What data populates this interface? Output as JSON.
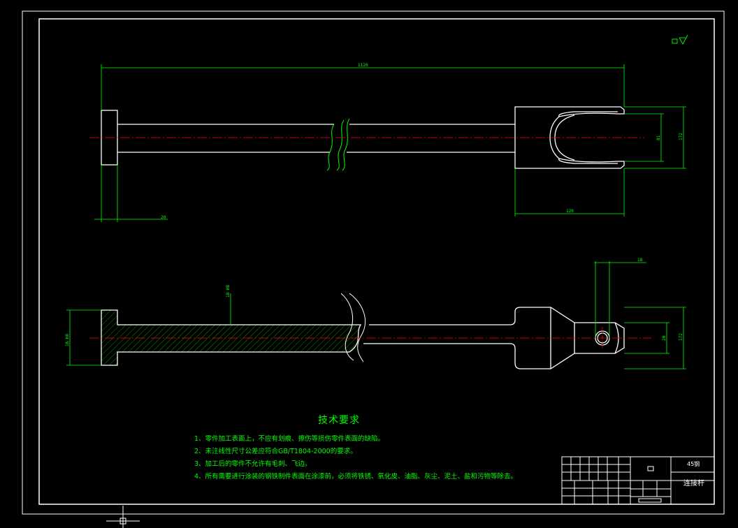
{
  "drawing": {
    "dimensions": {
      "overall_length": "1120",
      "head_thickness": "20",
      "fork_length": "120",
      "fork_opening": "81",
      "fork_height": "172",
      "bottom_slot": "20",
      "pin_hole": "18",
      "bottom_fork_height": "172",
      "shaft_dia": "18 H8",
      "head_dia": "16 H8"
    },
    "symbol_label": "▭∀"
  },
  "technical_requirements": {
    "title": "技术要求",
    "items": [
      "1、零件加工表面上，不应有划痕、擦伤等损伤零件表面的缺陷。",
      "2、未注线性尺寸公差应符合GB/T1804-2000的要求。",
      "3、加工后的零件不允许有毛刺、飞边。",
      "4、所有需要进行涂装的钢铁制件表面在涂漆前，必须将铁锈、氧化皮、油脂、灰尘、泥土、盐和污物等除去。"
    ]
  },
  "title_block": {
    "material": "45钢",
    "part_name": "连接杆",
    "scale_box": "□"
  },
  "colors": {
    "background": "#000000",
    "outline": "#ffffff",
    "dimension": "#00ff00",
    "centerline": "#ff0000",
    "hatch": "#00ff00"
  }
}
